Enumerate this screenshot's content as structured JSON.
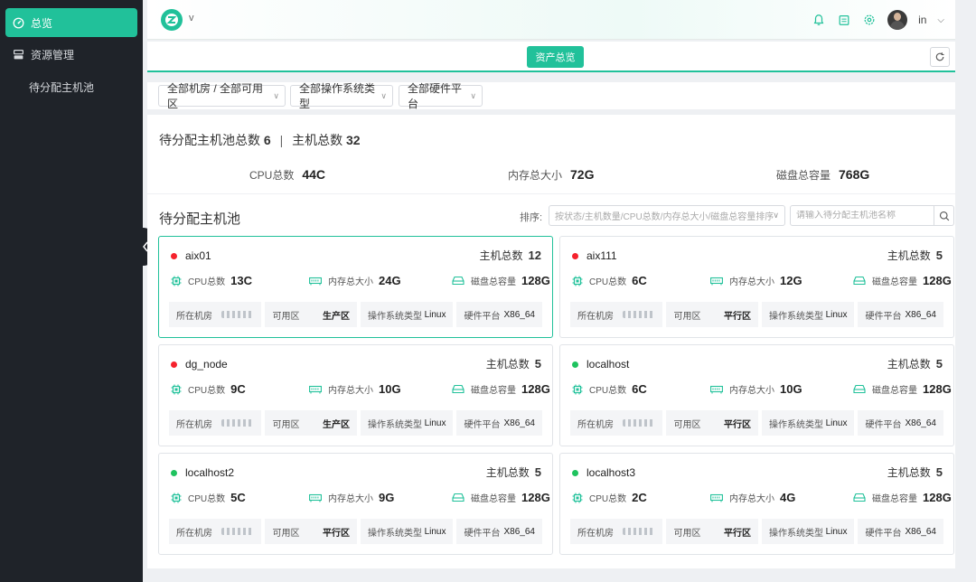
{
  "sidebar": {
    "items": [
      {
        "label": "总览",
        "icon": "dashboard-icon",
        "active": true
      },
      {
        "label": "资源管理",
        "icon": "server-icon",
        "active": false
      }
    ],
    "subitem": "待分配主机池"
  },
  "header": {
    "brand": "v",
    "user": "in",
    "icons": [
      "bell-icon",
      "calendar-icon",
      "settings-icon"
    ]
  },
  "tabs": {
    "active_label": "资产总览"
  },
  "filters": [
    {
      "label": "全部机房 / 全部可用区"
    },
    {
      "label": "全部操作系统类型"
    },
    {
      "label": "全部硬件平台"
    }
  ],
  "summary": {
    "pool_label": "待分配主机池总数",
    "pool_count": "6",
    "host_label": "主机总数",
    "host_count": "32",
    "cpu_label": "CPU总数",
    "cpu_value": "44C",
    "mem_label": "内存总大小",
    "mem_value": "72G",
    "disk_label": "磁盘总容量",
    "disk_value": "768G"
  },
  "pool": {
    "title": "待分配主机池",
    "sort_label": "排序:",
    "sort_placeholder": "按状态/主机数量/CPU总数/内存总大小/磁盘总容量排序",
    "search_placeholder": "请输入待分配主机池名称"
  },
  "card_labels": {
    "total": "主机总数",
    "cpu": "CPU总数",
    "mem": "内存总大小",
    "disk": "磁盘总容量",
    "room": "所在机房",
    "zone": "可用区",
    "os": "操作系统类型",
    "hw": "硬件平台"
  },
  "cards": [
    {
      "name": "aix01",
      "status": "red",
      "total": "12",
      "cpu": "13C",
      "mem": "24G",
      "disk": "128G",
      "zone": "生产区",
      "os": "Linux",
      "hw": "X86_64"
    },
    {
      "name": "aix111",
      "status": "red",
      "total": "5",
      "cpu": "6C",
      "mem": "12G",
      "disk": "128G",
      "zone": "平行区",
      "os": "Linux",
      "hw": "X86_64"
    },
    {
      "name": "dg_node",
      "status": "red",
      "total": "5",
      "cpu": "9C",
      "mem": "10G",
      "disk": "128G",
      "zone": "生产区",
      "os": "Linux",
      "hw": "X86_64"
    },
    {
      "name": "localhost",
      "status": "green",
      "total": "5",
      "cpu": "6C",
      "mem": "10G",
      "disk": "128G",
      "zone": "平行区",
      "os": "Linux",
      "hw": "X86_64"
    },
    {
      "name": "localhost2",
      "status": "green",
      "total": "5",
      "cpu": "5C",
      "mem": "9G",
      "disk": "128G",
      "zone": "平行区",
      "os": "Linux",
      "hw": "X86_64"
    },
    {
      "name": "localhost3",
      "status": "green",
      "total": "5",
      "cpu": "2C",
      "mem": "4G",
      "disk": "128G",
      "zone": "平行区",
      "os": "Linux",
      "hw": "X86_64"
    }
  ],
  "colors": {
    "accent": "#21c19a",
    "status_red": "#f5222d",
    "status_green": "#1fc35f"
  }
}
